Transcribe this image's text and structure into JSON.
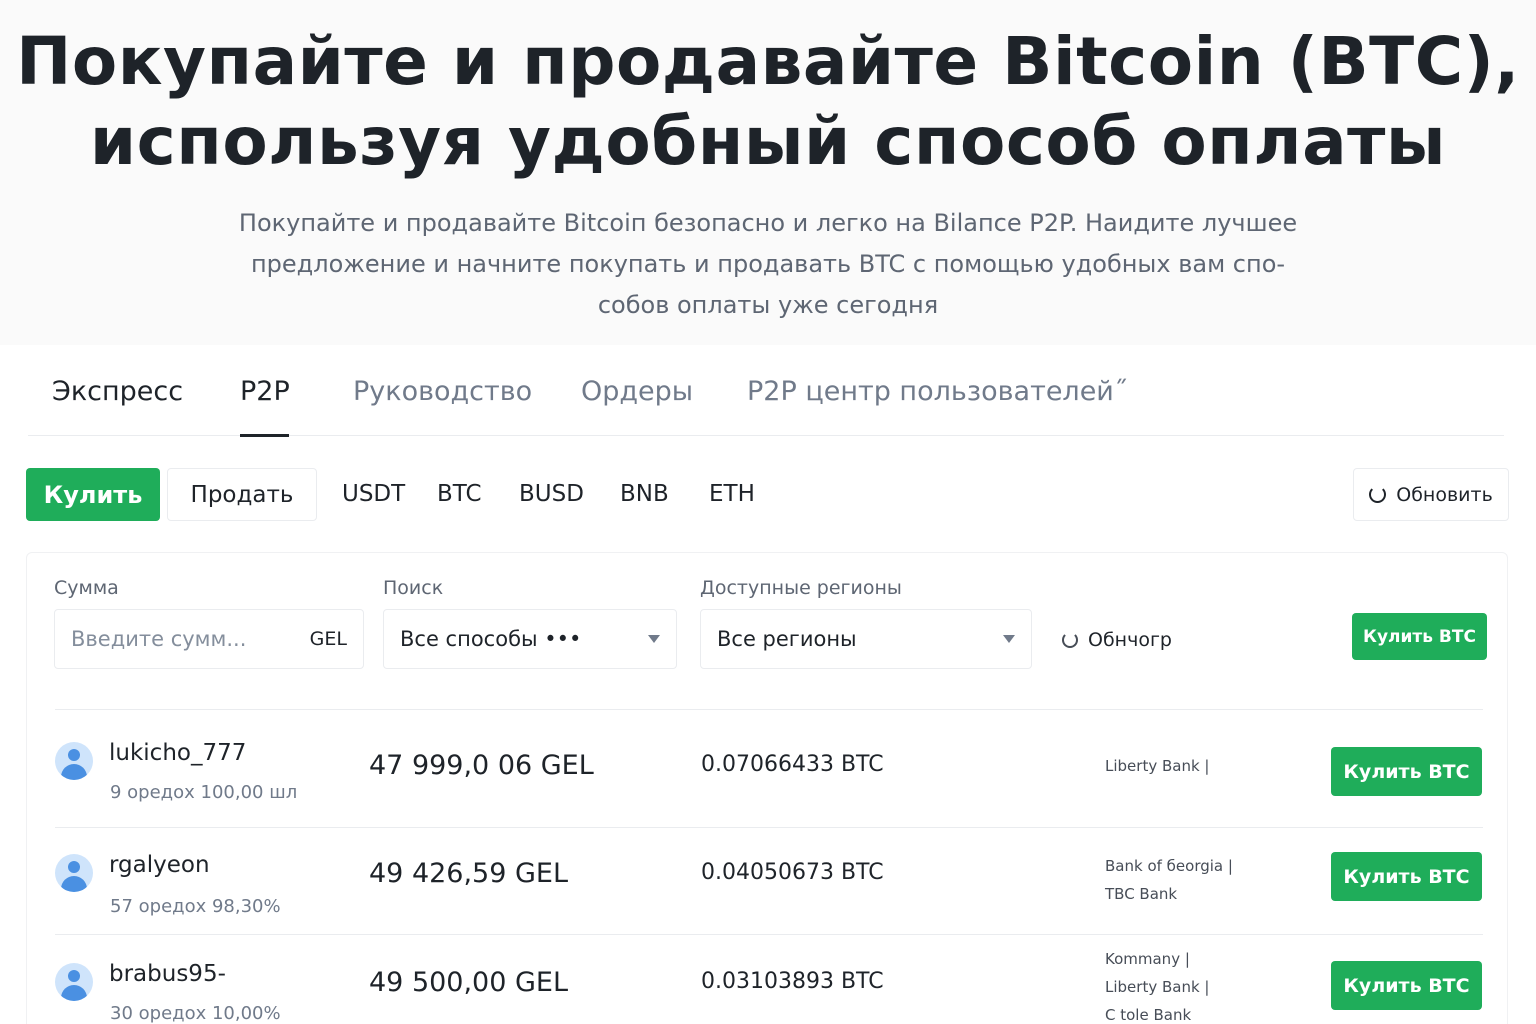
{
  "hero": {
    "title_line1": "Покупайте и продавайте Bitcoin (BTC),",
    "title_line2": "используя удобный способ оплаты",
    "subtitle_line1": "Покупайте и продавайте Bitcoiп безопасно и легко на Віlапсе P2P. Наидите лучшее",
    "subtitle_line2": "предложение и начните покупать и продавать BTC с помощью удобных вам спо-",
    "subtitle_line3": "собов оплаты уже сегодня"
  },
  "tabs": [
    {
      "label": "Экспресс"
    },
    {
      "label": "P2P"
    },
    {
      "label": "Руководство"
    },
    {
      "label": "Ордеры"
    },
    {
      "label": "P2P центр пользователей˝"
    }
  ],
  "toolbar": {
    "buy_label": "Кулить",
    "sell_label": "Продать",
    "coins": [
      "USDT",
      "BTC",
      "BUSD",
      "BNB",
      "ETH"
    ],
    "refresh_label": "Обновить"
  },
  "filters": {
    "amount_label": "Сумма",
    "amount_placeholder": "Введите сумм...",
    "amount_currency": "GEL",
    "search_label": "Поиск",
    "search_value": "Все способы •••",
    "regions_label": "Доступные регионы",
    "regions_value": "Все регионы",
    "refresh_label": "Обнчогр",
    "buy_label": "Кулить BTC"
  },
  "rows": [
    {
      "name": "lukicho_777",
      "stats": "9 оредох 100,00 шл",
      "price": "47 999,0 06 GEL",
      "amount": "0.07066433 BTC",
      "banks": [
        "Liberty Bank |"
      ],
      "buy_label": "Кулить BTC"
    },
    {
      "name": "rgalyeon",
      "stats": "57 оредох 98,30%",
      "price": "49 426,59 GEL",
      "amount": "0.04050673 BTC",
      "banks": [
        "Bank of бeorgia |",
        "TBC Bank"
      ],
      "buy_label": "Кулить BTC"
    },
    {
      "name": "brabus95-",
      "stats": "30 оредох 10,00%",
      "price": "49 500,00 GEL",
      "amount": "0.03103893 BTC",
      "banks": [
        "Kommany |",
        "Liberty Bank |",
        "C tole Bank"
      ],
      "buy_label": "Кулить BTC"
    }
  ],
  "colors": {
    "accent_green": "#1fad5a",
    "text_primary": "#1e2329",
    "text_secondary": "#707a8a"
  }
}
